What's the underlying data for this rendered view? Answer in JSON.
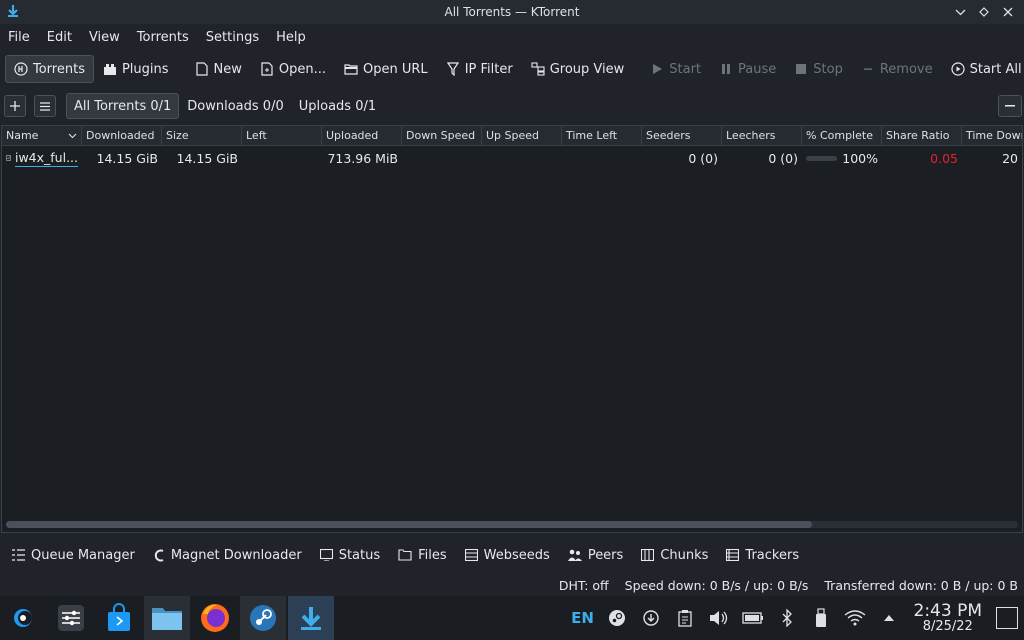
{
  "window": {
    "title": "All Torrents — KTorrent",
    "accent_color": "#3daee9"
  },
  "menu": [
    "File",
    "Edit",
    "View",
    "Torrents",
    "Settings",
    "Help"
  ],
  "toolbar": {
    "torrents": "Torrents",
    "plugins": "Plugins",
    "new": "New",
    "open": "Open...",
    "open_url": "Open URL",
    "ip_filter": "IP Filter",
    "group_view": "Group View",
    "start": "Start",
    "pause": "Pause",
    "stop": "Stop",
    "remove": "Remove",
    "start_all": "Start All"
  },
  "tabs": [
    "All Torrents 0/1",
    "Downloads 0/0",
    "Uploads 0/1"
  ],
  "table": {
    "columns": [
      "Name",
      "Downloaded",
      "Size",
      "Left",
      "Uploaded",
      "Down Speed",
      "Up Speed",
      "Time Left",
      "Seeders",
      "Leechers",
      "% Complete",
      "Share Ratio",
      "Time Downlo"
    ],
    "rows": [
      {
        "name": "iw4x_ful...",
        "downloaded": "14.15 GiB",
        "size": "14.15 GiB",
        "left": "",
        "uploaded": "713.96 MiB",
        "down_speed": "",
        "up_speed": "",
        "time_left": "",
        "seeders": "0 (0)",
        "leechers": "0 (0)",
        "complete": "100%",
        "complete_fraction": 1.0,
        "share_ratio": "0.05",
        "time_downloaded": "20"
      }
    ]
  },
  "bottom_tabs": [
    "Queue Manager",
    "Magnet Downloader",
    "Status",
    "Files",
    "Webseeds",
    "Peers",
    "Chunks",
    "Trackers"
  ],
  "status": {
    "dht": "DHT: off",
    "speed": "Speed down: 0 B/s / up: 0 B/s",
    "transferred": "Transferred down: 0 B / up: 0 B"
  },
  "taskbar": {
    "apps": [
      "application-launcher-icon",
      "system-settings-icon",
      "discover-store-icon",
      "dolphin-files-icon",
      "firefox-icon",
      "steam-icon",
      "ktorrent-icon"
    ],
    "lang": "EN",
    "time": "2:43 PM",
    "date": "8/25/22"
  }
}
